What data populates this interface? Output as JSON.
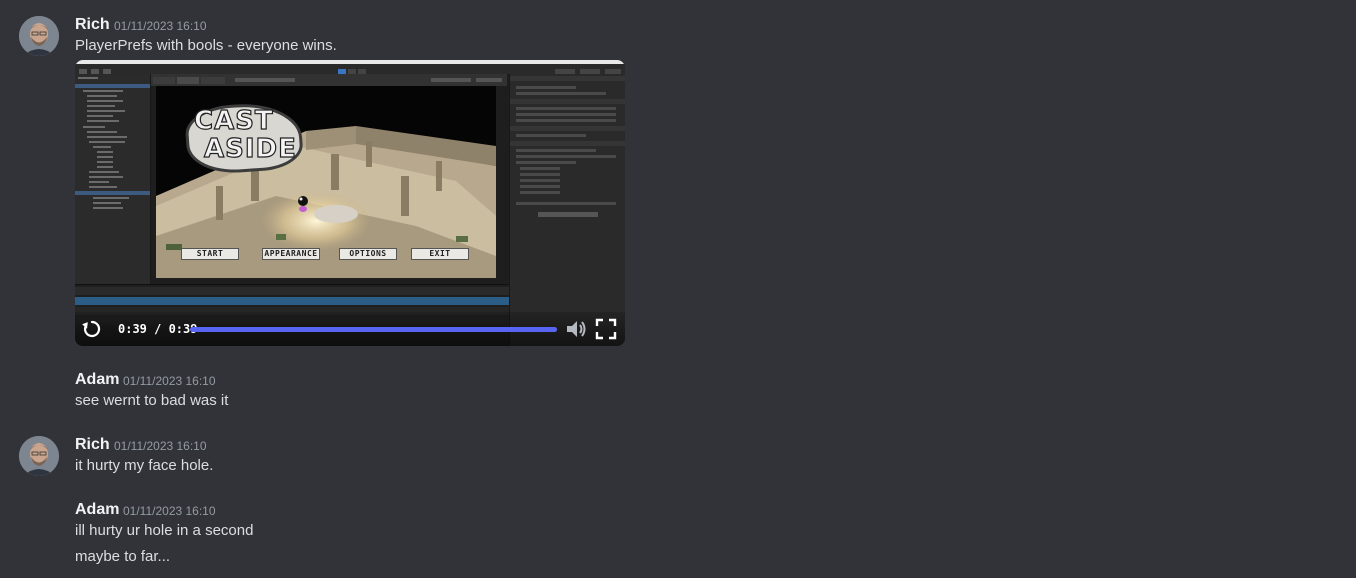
{
  "colors": {
    "background": "#313338",
    "username": "#f2f3f5",
    "timestamp": "#949ba4",
    "message_text": "#dbdee1",
    "progress_accent": "#5865f2"
  },
  "messages": [
    {
      "author": "Rich",
      "timestamp": "01/11/2023 16:10",
      "text": "PlayerPrefs with bools - everyone wins.",
      "attachment": {
        "type": "video",
        "time_display": "0:39 / 0:39",
        "progress": 1.0,
        "icons": [
          "replay-icon",
          "volume-icon",
          "fullscreen-icon"
        ],
        "thumbnail": {
          "game_title_line1": "CAST",
          "game_title_line2": "ASIDE",
          "menu_buttons": [
            "START",
            "APPEARANCE",
            "OPTIONS",
            "EXIT"
          ]
        }
      }
    },
    {
      "author": "Adam",
      "timestamp": "01/11/2023 16:10",
      "text": "see wernt to bad was it"
    },
    {
      "author": "Rich",
      "timestamp": "01/11/2023 16:10",
      "text": "it hurty my face hole."
    },
    {
      "author": "Adam",
      "timestamp": "01/11/2023 16:10",
      "text": "ill hurty ur hole in a second",
      "followup": "maybe to far..."
    }
  ]
}
